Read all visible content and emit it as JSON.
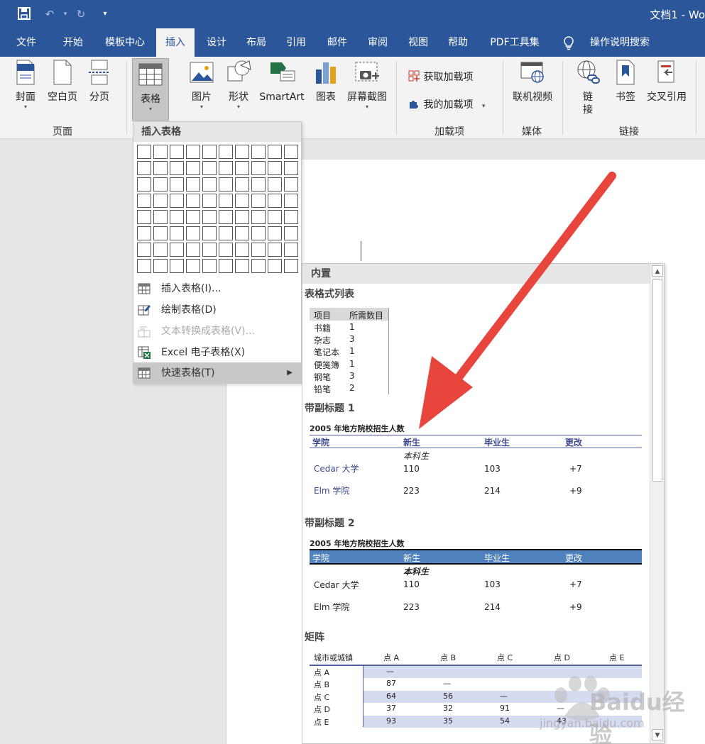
{
  "window": {
    "doc_title": "文档1 - Wo"
  },
  "tabs": [
    {
      "label": "文件",
      "active": false
    },
    {
      "label": "开始",
      "active": false
    },
    {
      "label": "模板中心",
      "active": false
    },
    {
      "label": "插入",
      "active": true
    },
    {
      "label": "设计",
      "active": false
    },
    {
      "label": "布局",
      "active": false
    },
    {
      "label": "引用",
      "active": false
    },
    {
      "label": "邮件",
      "active": false
    },
    {
      "label": "审阅",
      "active": false
    },
    {
      "label": "视图",
      "active": false
    },
    {
      "label": "帮助",
      "active": false
    },
    {
      "label": "PDF工具集",
      "active": false
    }
  ],
  "tell_me": "操作说明搜索",
  "ribbon": {
    "pages_group": {
      "label": "页面",
      "cover": "封面",
      "blank": "空白页",
      "page_break": "分页"
    },
    "table": "表格",
    "illustrations": {
      "picture": "图片",
      "shapes": "形状",
      "smartart": "SmartArt",
      "chart": "图表",
      "screenshot": "屏幕截图"
    },
    "addins_group": {
      "label": "加载项",
      "get": "获取加载项",
      "my": "我的加载项"
    },
    "media_group": {
      "label": "媒体",
      "online_video": "联机视频"
    },
    "links_group": {
      "label": "链接",
      "link_line1": "链",
      "link_line2": "接",
      "bookmark": "书签",
      "cross_ref": "交叉引用"
    }
  },
  "insert_table_menu": {
    "header": "插入表格",
    "grid_cols": 10,
    "grid_rows": 8,
    "items": [
      {
        "label": "插入表格(I)...",
        "disabled": false
      },
      {
        "label": "绘制表格(D)",
        "disabled": false
      },
      {
        "label": "文本转换成表格(V)...",
        "disabled": true
      },
      {
        "label": "Excel 电子表格(X)",
        "disabled": false
      },
      {
        "label": "快速表格(T)",
        "disabled": false
      }
    ]
  },
  "quick_tables": {
    "header": "内置",
    "sections": {
      "tabular_list": {
        "title": "表格式列表",
        "col1": "项目",
        "col2": "所需数目",
        "rows": [
          {
            "item": "书籍",
            "qty": "1"
          },
          {
            "item": "杂志",
            "qty": "3"
          },
          {
            "item": "笔记本",
            "qty": "1"
          },
          {
            "item": "便笺簿",
            "qty": "1"
          },
          {
            "item": "钢笔",
            "qty": "3"
          },
          {
            "item": "铅笔",
            "qty": "2"
          }
        ]
      },
      "subheading1": {
        "title": "带副标题 1",
        "caption": "2005  年地方院校招生人数",
        "headers": [
          "学院",
          "新生",
          "毕业生",
          "更改"
        ],
        "sub": "本科生",
        "rows": [
          [
            "Cedar 大学",
            "110",
            "103",
            "+7"
          ],
          [
            "Elm 学院",
            "223",
            "214",
            "+9"
          ]
        ]
      },
      "subheading2": {
        "title": "带副标题 2",
        "caption": "2005  年地方院校招生人数",
        "headers": [
          "学院",
          "新生",
          "毕业生",
          "更改"
        ],
        "sub": "本科生",
        "rows": [
          [
            "Cedar 大学",
            "110",
            "103",
            "+7"
          ],
          [
            "Elm 学院",
            "223",
            "214",
            "+9"
          ]
        ]
      },
      "matrix": {
        "title": "矩阵",
        "headers": [
          "城市或城镇",
          "点 A",
          "点 B",
          "点 C",
          "点 D",
          "点 E"
        ],
        "rows": [
          [
            "点 A",
            "—",
            "",
            "",
            "",
            ""
          ],
          [
            "点 B",
            "87",
            "—",
            "",
            "",
            ""
          ],
          [
            "点 C",
            "64",
            "56",
            "—",
            "",
            ""
          ],
          [
            "点 D",
            "37",
            "32",
            "91",
            "—",
            ""
          ],
          [
            "点 E",
            "93",
            "35",
            "54",
            "43",
            ""
          ]
        ]
      }
    }
  },
  "watermark": {
    "text": "Baidu经验",
    "sub": "jingyan.baidu.com"
  },
  "colors": {
    "ribbon_blue": "#2b579a",
    "accent_blue": "#4f81bd",
    "arrow_red": "#e8453c"
  }
}
